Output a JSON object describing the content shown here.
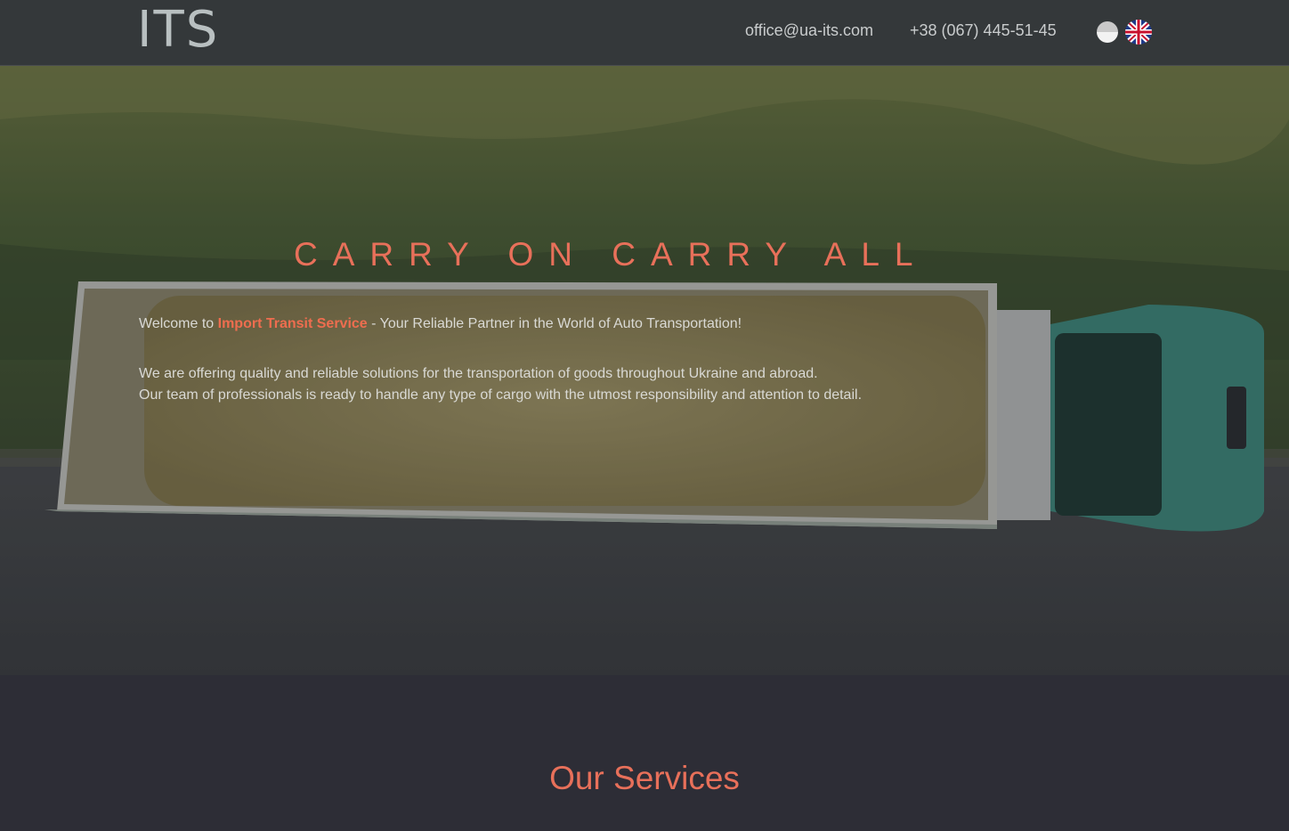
{
  "header": {
    "logo_text": "ITS",
    "email": "office@ua-its.com",
    "phone": "+38 (067) 445-51-45"
  },
  "hero": {
    "headline": "CARRY ON CARRY ALL",
    "welcome_prefix": "Welcome to ",
    "welcome_brand": "Import Transit Service",
    "welcome_suffix": " - Your Reliable Partner in the World of Auto Transportation!",
    "line1": "We are offering quality and reliable solutions for the transportation of goods throughout Ukraine and abroad.",
    "line2": "Our team of professionals is ready to handle any type of cargo with the utmost responsibility and attention to detail."
  },
  "services": {
    "title": "Our Services"
  },
  "colors": {
    "accent": "#e8705a",
    "header_bg": "#34383a",
    "page_bg": "#2d2d36"
  }
}
